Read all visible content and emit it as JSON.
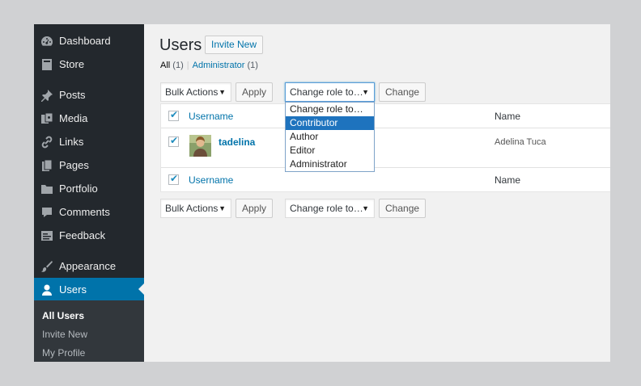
{
  "sidebar": {
    "items": [
      {
        "label": "Dashboard",
        "icon": "dashboard-icon"
      },
      {
        "label": "Store",
        "icon": "store-icon"
      },
      {
        "label": "Posts",
        "icon": "pushpin-icon"
      },
      {
        "label": "Media",
        "icon": "media-icon"
      },
      {
        "label": "Links",
        "icon": "link-icon"
      },
      {
        "label": "Pages",
        "icon": "pages-icon"
      },
      {
        "label": "Portfolio",
        "icon": "folder-icon"
      },
      {
        "label": "Comments",
        "icon": "comment-icon"
      },
      {
        "label": "Feedback",
        "icon": "feedback-icon"
      },
      {
        "label": "Appearance",
        "icon": "brush-icon"
      },
      {
        "label": "Users",
        "icon": "user-icon"
      }
    ],
    "submenu": [
      "All Users",
      "Invite New",
      "My Profile"
    ]
  },
  "header": {
    "title": "Users",
    "add_button": "Invite New"
  },
  "filters": {
    "all": "All",
    "all_count": "(1)",
    "separator": "|",
    "admin": "Administrator",
    "admin_count": "(1)"
  },
  "toolbar": {
    "bulk_actions": "Bulk Actions",
    "apply": "Apply",
    "change_role": "Change role to…",
    "change": "Change"
  },
  "table": {
    "columns": [
      "Username",
      "Name"
    ],
    "rows": [
      {
        "username": "tadelina",
        "name": "Adelina Tuca"
      }
    ]
  },
  "role_dropdown": {
    "options": [
      "Change role to…",
      "Contributor",
      "Author",
      "Editor",
      "Administrator"
    ],
    "highlighted": "Contributor"
  },
  "colors": {
    "sidebar_bg": "#23282d",
    "accent": "#0073aa",
    "highlight": "#1e73be"
  }
}
